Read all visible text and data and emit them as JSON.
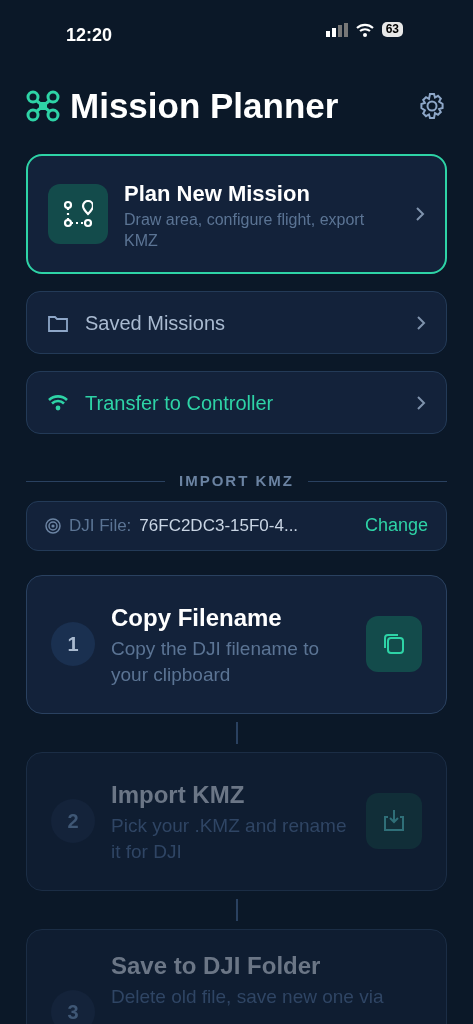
{
  "status_bar": {
    "time": "12:20",
    "battery": "63"
  },
  "header": {
    "title": "Mission Planner"
  },
  "menu": [
    {
      "kind": "featured",
      "title": "Plan New Mission",
      "subtitle": "Draw area, configure flight, export KMZ",
      "highlighted": true
    },
    {
      "kind": "plain",
      "title": "Saved Missions",
      "highlighted": false
    },
    {
      "kind": "plain",
      "title": "Transfer to Controller",
      "highlighted": true
    }
  ],
  "section": {
    "title": "IMPORT KMZ"
  },
  "file_row": {
    "label": "DJI File:",
    "value": "76FC2DC3-15F0-4...",
    "action": "Change"
  },
  "steps": [
    {
      "number": "1",
      "title": "Copy Filename",
      "description": "Copy the DJI filename to your clipboard",
      "disabled": false
    },
    {
      "number": "2",
      "title": "Import KMZ",
      "description": "Pick your .KMZ and rename it for DJI",
      "disabled": true
    },
    {
      "number": "3",
      "title": "Save to DJI Folder",
      "description": "Delete old file, save new one via",
      "disabled": true
    }
  ]
}
